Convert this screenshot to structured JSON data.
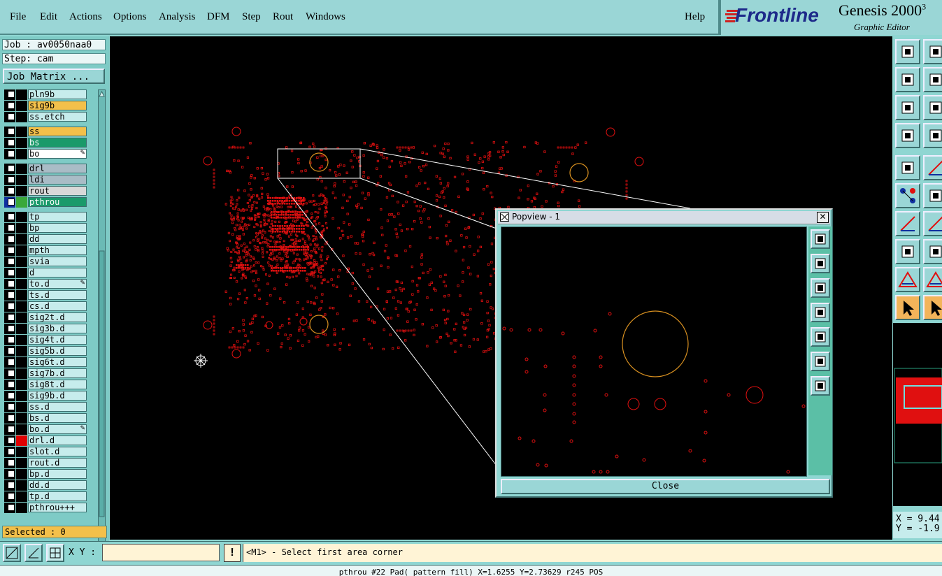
{
  "menubar": {
    "items": [
      "File",
      "Edit",
      "Actions",
      "Options",
      "Analysis",
      "DFM",
      "Step",
      "Rout",
      "Windows"
    ],
    "help": "Help"
  },
  "brand": {
    "company": "Frontline",
    "product": "Genesis 2000",
    "version_sup": "3",
    "subtitle": "Graphic Editor"
  },
  "job": {
    "job_label": "Job : av0050naa0",
    "step_label": "Step: cam",
    "matrix_button": "Job Matrix ..."
  },
  "layers": [
    {
      "name": "pln9b",
      "color": "#c6ecec",
      "swatch": "#000000"
    },
    {
      "name": "sig9b",
      "color": "#f3c04a",
      "swatch": "#000000"
    },
    {
      "name": "ss.etch",
      "color": "#c6ecec",
      "swatch": "#000000"
    },
    {
      "name": "ss",
      "color": "#f3c04a",
      "swatch": "#000000"
    },
    {
      "name": "bs",
      "color": "#1a9a6a",
      "swatch": "#000000"
    },
    {
      "name": "bo",
      "color": "#ffffff",
      "swatch": "#000000",
      "mark": "pencil"
    },
    {
      "name": "drl",
      "color": "#a9bcc6",
      "swatch": "#000000"
    },
    {
      "name": "ldi",
      "color": "#a9bcc6",
      "swatch": "#000000"
    },
    {
      "name": "rout",
      "color": "#d8d8d8",
      "swatch": "#000000"
    },
    {
      "name": "pthrou",
      "color": "#1a9a6a",
      "swatch": "#3aa83a",
      "active": true
    },
    {
      "name": "tp",
      "color": "#c6ecec",
      "swatch": "#000000"
    },
    {
      "name": "bp",
      "color": "#c6ecec",
      "swatch": "#000000"
    },
    {
      "name": "dd",
      "color": "#c6ecec",
      "swatch": "#000000"
    },
    {
      "name": "mpth",
      "color": "#c6ecec",
      "swatch": "#000000"
    },
    {
      "name": "svia",
      "color": "#c6ecec",
      "swatch": "#000000"
    },
    {
      "name": "d",
      "color": "#c6ecec",
      "swatch": "#000000"
    },
    {
      "name": "to.d",
      "color": "#c6ecec",
      "swatch": "#000000",
      "mark": "pencil"
    },
    {
      "name": "ts.d",
      "color": "#c6ecec",
      "swatch": "#000000"
    },
    {
      "name": "cs.d",
      "color": "#c6ecec",
      "swatch": "#000000"
    },
    {
      "name": "sig2t.d",
      "color": "#c6ecec",
      "swatch": "#000000"
    },
    {
      "name": "sig3b.d",
      "color": "#c6ecec",
      "swatch": "#000000"
    },
    {
      "name": "sig4t.d",
      "color": "#c6ecec",
      "swatch": "#000000"
    },
    {
      "name": "sig5b.d",
      "color": "#c6ecec",
      "swatch": "#000000"
    },
    {
      "name": "sig6t.d",
      "color": "#c6ecec",
      "swatch": "#000000"
    },
    {
      "name": "sig7b.d",
      "color": "#c6ecec",
      "swatch": "#000000"
    },
    {
      "name": "sig8t.d",
      "color": "#c6ecec",
      "swatch": "#000000"
    },
    {
      "name": "sig9b.d",
      "color": "#c6ecec",
      "swatch": "#000000"
    },
    {
      "name": "ss.d",
      "color": "#c6ecec",
      "swatch": "#000000"
    },
    {
      "name": "bs.d",
      "color": "#c6ecec",
      "swatch": "#000000"
    },
    {
      "name": "bo.d",
      "color": "#c6ecec",
      "swatch": "#000000",
      "mark": "pencil"
    },
    {
      "name": "drl.d",
      "color": "#c6ecec",
      "swatch": "#e00000"
    },
    {
      "name": "slot.d",
      "color": "#c6ecec",
      "swatch": "#000000"
    },
    {
      "name": "rout.d",
      "color": "#c6ecec",
      "swatch": "#000000"
    },
    {
      "name": "bp.d",
      "color": "#c6ecec",
      "swatch": "#000000"
    },
    {
      "name": "dd.d",
      "color": "#c6ecec",
      "swatch": "#000000"
    },
    {
      "name": "tp.d",
      "color": "#c6ecec",
      "swatch": "#000000"
    },
    {
      "name": "pthrou+++",
      "color": "#c6ecec",
      "swatch": "#000000"
    }
  ],
  "selected": "Selected : 0",
  "popview": {
    "title": "Popview - 1",
    "close_label": "Close",
    "tools": [
      "zoom-fit-icon",
      "pan-up-icon",
      "pan-down-icon",
      "pan-left-icon",
      "pan-right-icon",
      "zoom-out-icon",
      "zoom-in-icon"
    ]
  },
  "right_tools": [
    "pan-up-icon",
    "pan-down-icon",
    "pan-left-icon",
    "pan-right-icon",
    "zoom-out-icon",
    "zoom-in-icon",
    "measure-icon",
    "pad-icon",
    "snap-icon",
    "add-line-icon",
    "net-icon",
    "cut-icon",
    "line-icon",
    "line-angle-icon",
    "feature-icon",
    "connect-icon",
    "triangle-icon",
    "arrow-up-icon",
    "select-arrow-icon",
    "select-arrow-active-icon"
  ],
  "coords": {
    "x": "X = 9.44",
    "y": "Y = -1.9"
  },
  "bottombar": {
    "xy_label": "X Y :",
    "xy_value": "",
    "warn_label": "!",
    "prompt": "<M1> - Select first area corner"
  },
  "status": "pthrou #22 Pad( pattern fill) X=1.6255 Y=2.73629 r245 POS",
  "colors": {
    "panel": "#8fd6d2",
    "feature_red": "#e01010",
    "highlight_orange": "#f3c04a"
  }
}
